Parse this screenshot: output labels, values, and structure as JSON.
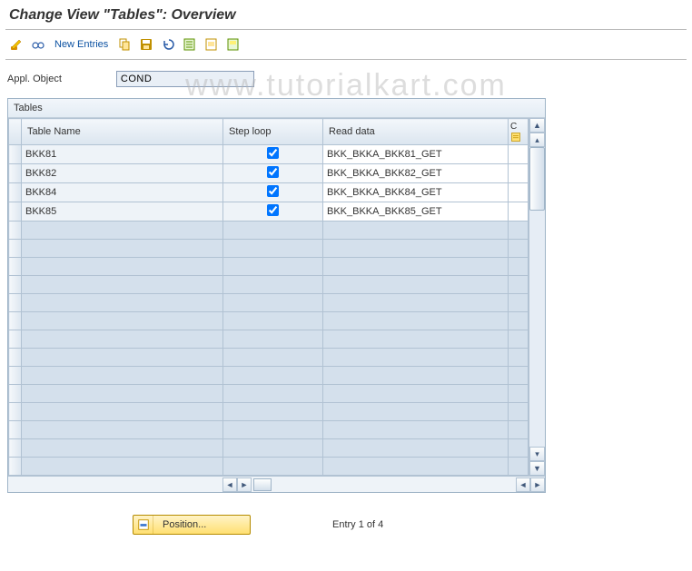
{
  "title": "Change View \"Tables\": Overview",
  "toolbar": {
    "new_entries_label": "New Entries",
    "icons": {
      "pencil": "pencil-eraser-icon",
      "glasses": "glasses-icon",
      "copy": "copy-icon",
      "save": "save-icon",
      "undo": "undo-icon",
      "sheet1": "select-all-icon",
      "sheet2": "select-block-icon",
      "sheet3": "deselect-icon"
    }
  },
  "form": {
    "appl_object_label": "Appl. Object",
    "appl_object_value": "COND"
  },
  "table": {
    "title": "Tables",
    "columns": {
      "table_name": "Table Name",
      "step_loop": "Step loop",
      "read_data": "Read data",
      "c": "C"
    },
    "rows": [
      {
        "name": "BKK81",
        "step": true,
        "read": "BKK_BKKA_BKK81_GET"
      },
      {
        "name": "BKK82",
        "step": true,
        "read": "BKK_BKKA_BKK82_GET"
      },
      {
        "name": "BKK84",
        "step": true,
        "read": "BKK_BKKA_BKK84_GET"
      },
      {
        "name": "BKK85",
        "step": true,
        "read": "BKK_BKKA_BKK85_GET"
      }
    ],
    "empty_rows": 14
  },
  "footer": {
    "position_label": "Position...",
    "entry_status": "Entry 1 of 4"
  },
  "watermark": "www.tutorialkart.com"
}
